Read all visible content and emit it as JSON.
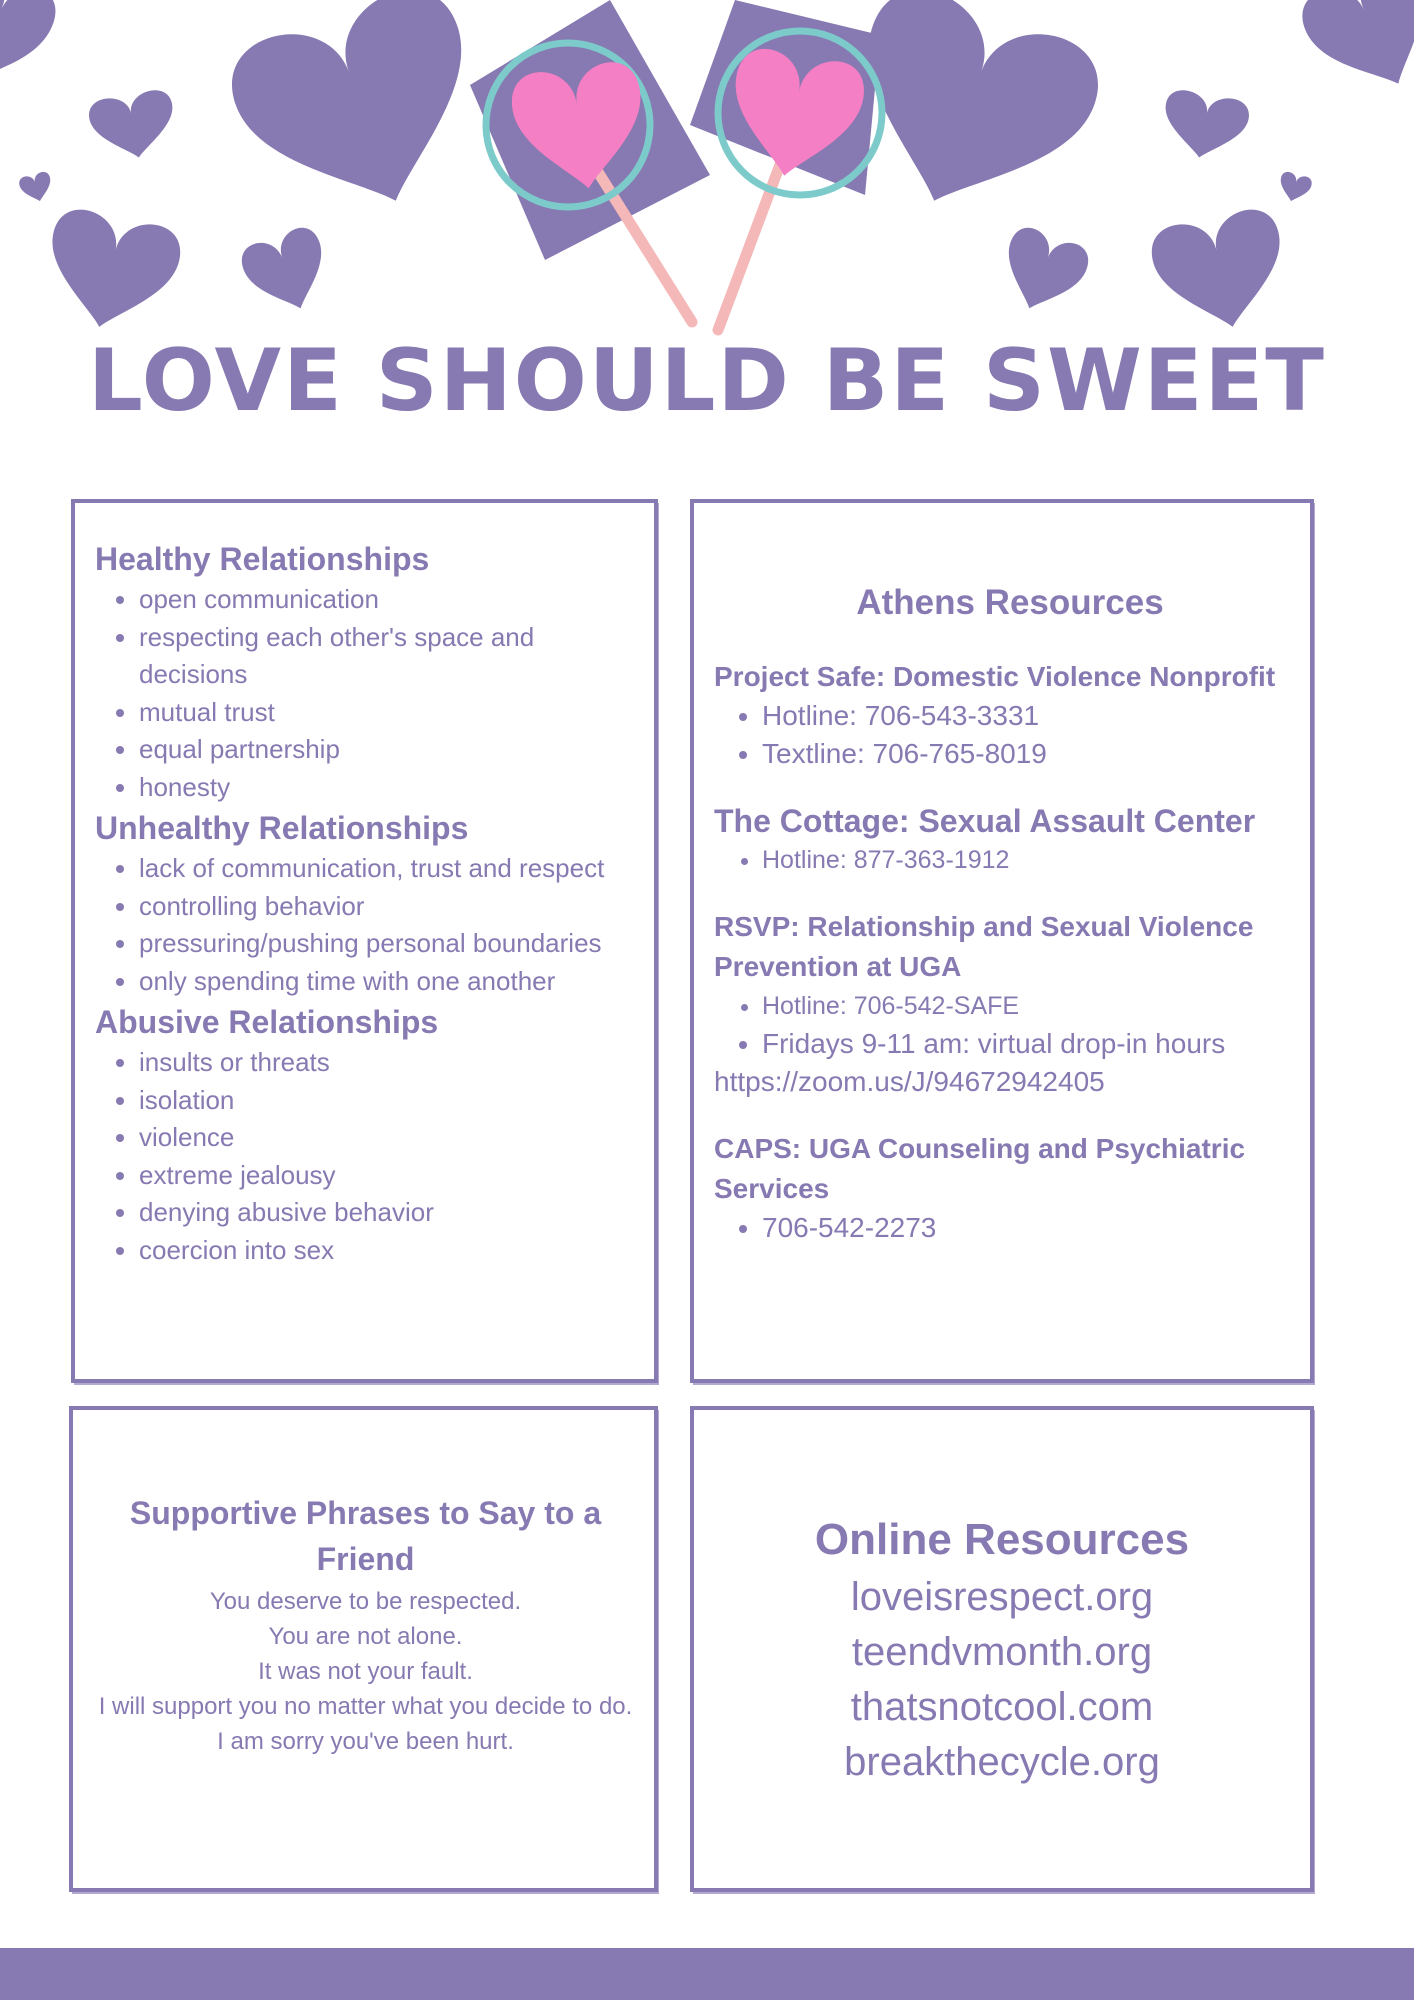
{
  "colors": {
    "accent": "#8779b1",
    "pink": "#f47fc4",
    "teal": "#7dcacb",
    "stick": "#f5b8b8"
  },
  "header": {
    "title": "LOVE SHOULD BE SWEET"
  },
  "relationships": [
    {
      "heading": "Healthy Relationships",
      "items": [
        "open communication",
        "respecting each other's space and decisions",
        "mutual trust",
        "equal partnership",
        "honesty"
      ]
    },
    {
      "heading": "Unhealthy Relationships",
      "items": [
        "lack of communication, trust and respect",
        "controlling behavior",
        "pressuring/pushing personal boundaries",
        "only spending time with one another"
      ]
    },
    {
      "heading": "Abusive Relationships",
      "items": [
        "insults or threats",
        "isolation",
        "violence",
        "extreme jealousy",
        "denying abusive behavior",
        "coercion into sex"
      ]
    }
  ],
  "athens": {
    "title": "Athens Resources",
    "orgs": [
      {
        "name": "Project Safe: Domestic Violence Nonprofit",
        "items": [
          "Hotline: 706-543-3331",
          "Textline: 706-765-8019"
        ]
      },
      {
        "name": "The Cottage: Sexual Assault Center",
        "items": [
          "Hotline: 877-363-1912"
        ]
      },
      {
        "name": "RSVP: Relationship and Sexual Violence Prevention at UGA",
        "items": [
          "Hotline: 706-542-SAFE",
          "Fridays 9-11 am: virtual drop-in hours"
        ],
        "url": "https://zoom.us/J/94672942405"
      },
      {
        "name": "CAPS: UGA Counseling and Psychiatric Services",
        "items": [
          "706-542-2273"
        ]
      }
    ]
  },
  "phrases": {
    "title": "Supportive Phrases to Say to a Friend",
    "lines": [
      "You deserve to be respected.",
      "You are not alone.",
      "It was not your fault.",
      "I will support you no matter what you decide to do.",
      "I am sorry you've been hurt."
    ]
  },
  "online": {
    "title": "Online Resources",
    "links": [
      "loveisrespect.org",
      "teendvmonth.org",
      "thatsnotcool.com",
      "breakthecycle.org"
    ]
  }
}
